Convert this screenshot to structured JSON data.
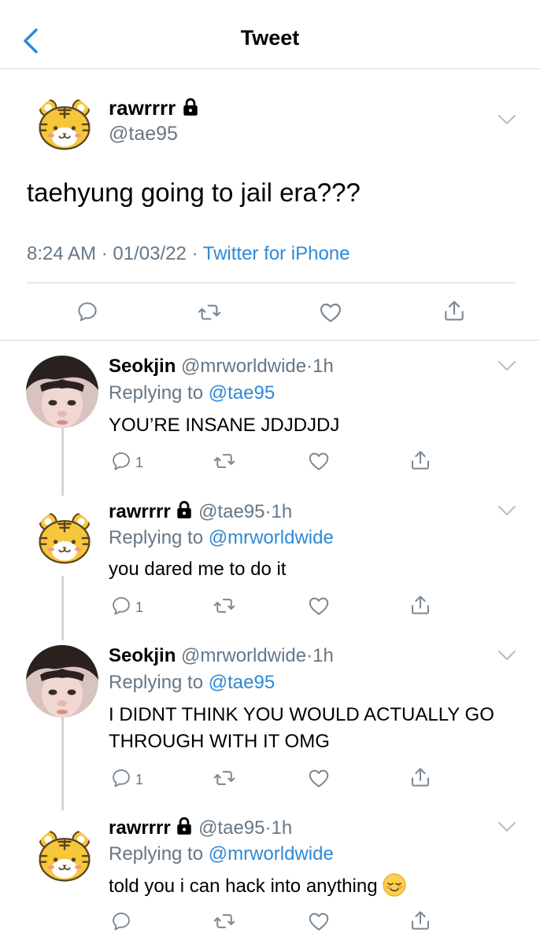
{
  "header": {
    "title": "Tweet"
  },
  "tweet": {
    "name": "rawrrrr",
    "handle": "@tae95",
    "text": "taehyung going to jail era???",
    "time": "8:24 AM",
    "date": "01/03/22",
    "sep": "·",
    "source": "Twitter for iPhone"
  },
  "replies": [
    {
      "name": "Seokjin",
      "handle": "@mrworldwide",
      "sep": "·",
      "time": "1h",
      "replying": "Replying to",
      "reply_to": "@tae95",
      "text": "YOU’RE INSANE JDJDJDJ",
      "reply_count": "1"
    },
    {
      "name": "rawrrrr",
      "handle": "@tae95",
      "sep": "·",
      "time": "1h",
      "replying": "Replying to",
      "reply_to": "@mrworldwide",
      "text": "you dared me to do it",
      "reply_count": "1"
    },
    {
      "name": "Seokjin",
      "handle": "@mrworldwide",
      "sep": "·",
      "time": "1h",
      "replying": "Replying to",
      "reply_to": "@tae95",
      "text": "I DIDNT THINK YOU WOULD ACTUALLY GO THROUGH WITH IT OMG",
      "reply_count": "1"
    },
    {
      "name": "rawrrrr",
      "handle": "@tae95",
      "sep": "·",
      "time": "1h",
      "replying": "Replying to",
      "reply_to": "@mrworldwide",
      "text": "told you i can hack into anything",
      "reply_count": ""
    }
  ],
  "icons": {
    "back": "chevron-left-icon",
    "lock": "lock-icon",
    "reply": "reply-icon",
    "retweet": "retweet-icon",
    "like": "heart-icon",
    "share": "share-icon",
    "more": "chevron-down-icon",
    "emoji": "relieved-face-emoji"
  },
  "colors": {
    "accent": "#2e89d6",
    "muted": "#657786",
    "divider": "#d6d9dc",
    "icon": "#7a8893"
  }
}
